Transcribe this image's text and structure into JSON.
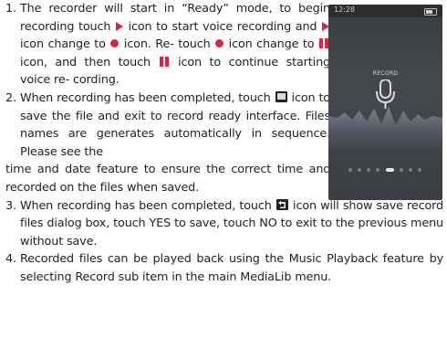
{
  "steps": [
    {
      "number": "1.",
      "lines": [
        [
          "t",
          "The recorder will start in “Ready” mode, to"
        ],
        [
          "t",
          "begin recording touch "
        ],
        [
          "icon",
          "play-icon"
        ],
        [
          "t",
          " icon to start voice"
        ],
        [
          "t",
          "recording and "
        ],
        [
          "icon",
          "play-icon"
        ],
        [
          "t",
          " icon change to "
        ],
        [
          "icon",
          "record-icon"
        ],
        [
          "t",
          " icon. Re-"
        ],
        [
          "t",
          "touch "
        ],
        [
          "icon",
          "record-icon"
        ],
        [
          "t",
          " icon change to "
        ],
        [
          "icon",
          "pause-icon"
        ],
        [
          "t",
          " icon, and then"
        ],
        [
          "t",
          "touch "
        ],
        [
          "icon",
          "pause-icon"
        ],
        [
          "t",
          " icon to continue starting voice re-"
        ],
        [
          "t",
          "cording."
        ]
      ]
    },
    {
      "number": "2.",
      "narrow_text": [
        "When recording has been completed, touch",
        " icon to save the file and exit to record",
        "ready interface. Files names are generates",
        "automatically in sequence. Please see the"
      ],
      "wide_text": "time and date feature to ensure the correct time and date stamp are recorded on the files when saved."
    },
    {
      "number": "3.",
      "text_a": "When recording has been completed, touch ",
      "text_b": " icon will show save record files dialog box, touch YES to save, touch NO to exit to the previous menu without save."
    },
    {
      "number": "4.",
      "text": "Recorded files can be played back using the Music Playback feature by selecting Record sub item in the main MediaLib menu."
    }
  ],
  "device": {
    "clock": "12:28",
    "record_label": "RECORD",
    "page_dots": 8,
    "active_dot": 4,
    "accent_color": "#e0243f"
  }
}
